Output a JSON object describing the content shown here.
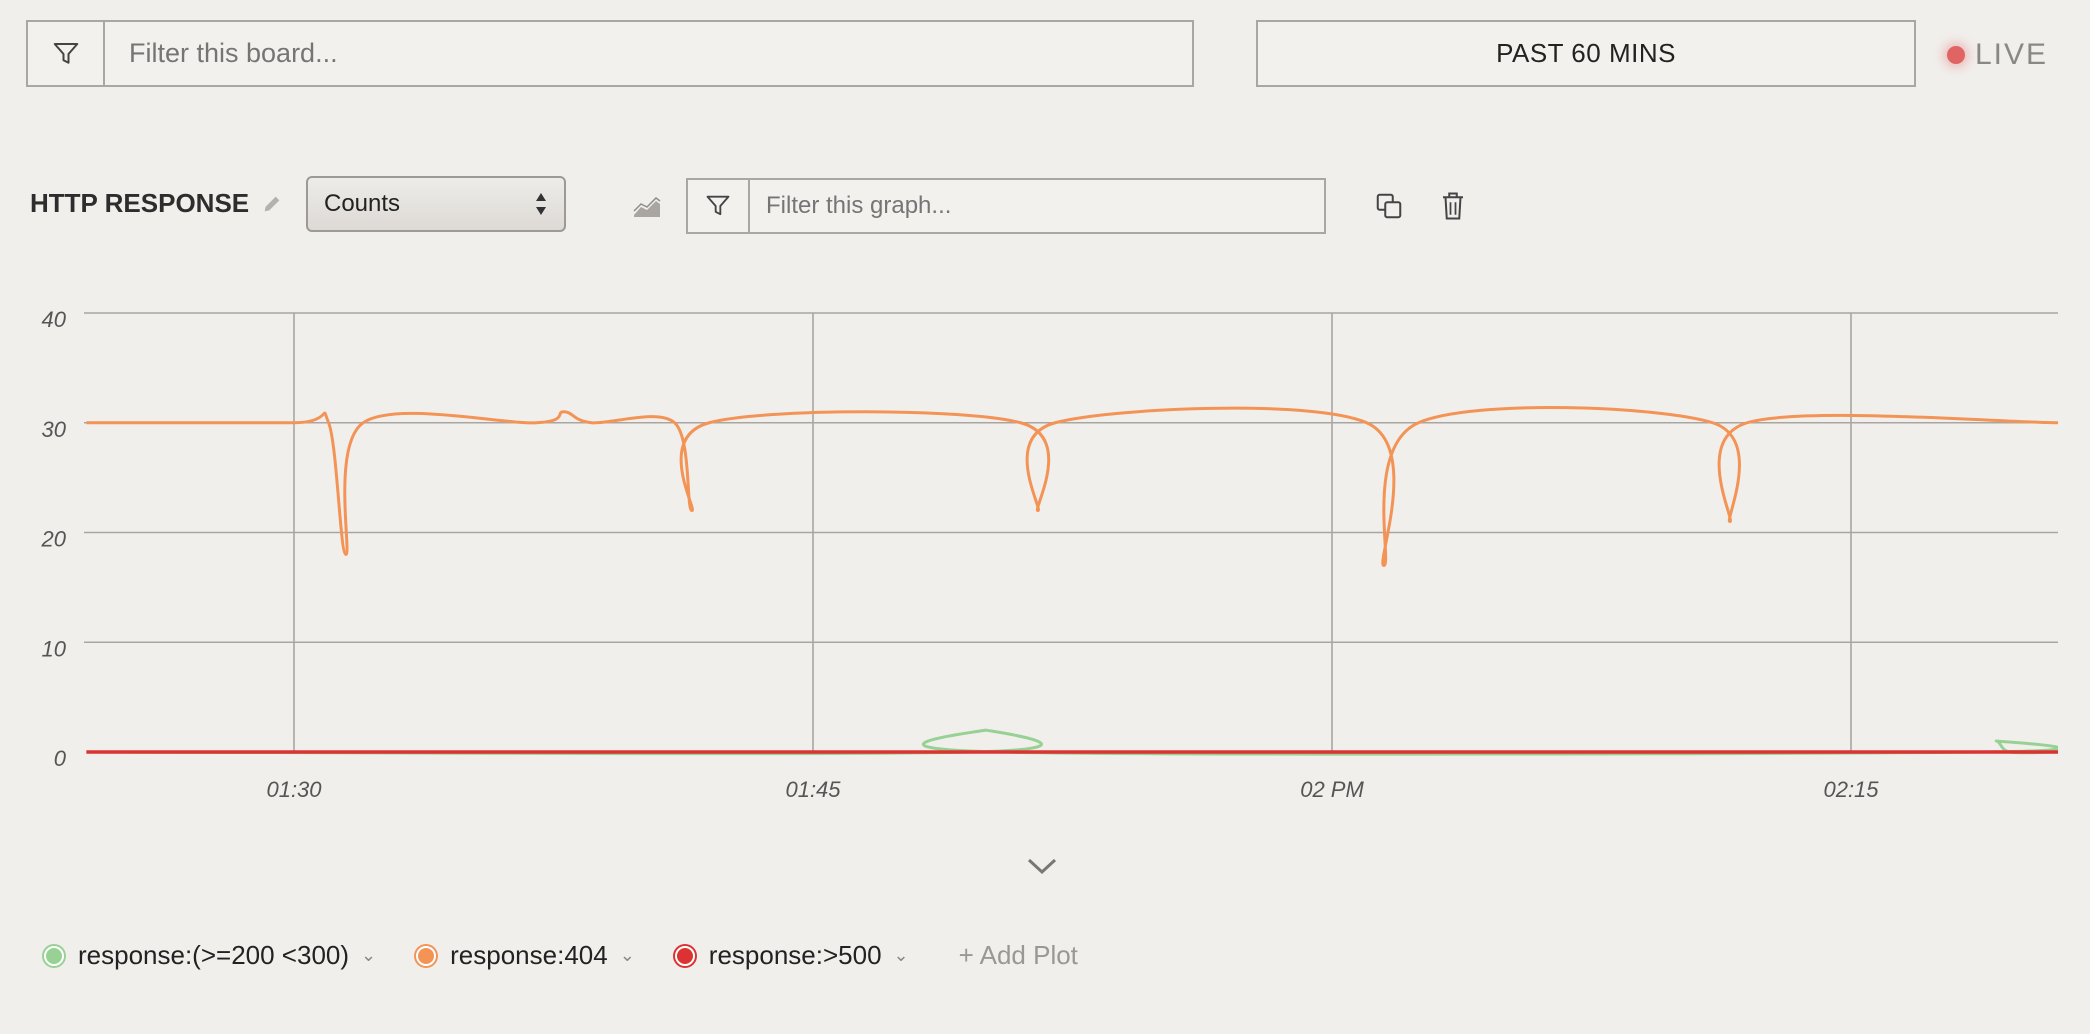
{
  "board_filter": {
    "placeholder": "Filter this board..."
  },
  "time_range": {
    "label": "PAST 60 MINS"
  },
  "live": {
    "label": "LIVE",
    "color": "#e06464"
  },
  "graph": {
    "title": "HTTP RESPONSE",
    "aggregation": "Counts",
    "filter_placeholder": "Filter this graph..."
  },
  "legend": {
    "items": [
      {
        "label": "response:(>=200 <300)",
        "color": "#98d194"
      },
      {
        "label": "response:404",
        "color": "#f39456"
      },
      {
        "label": "response:>500",
        "color": "#dc3232"
      }
    ],
    "add_plot": "+ Add Plot"
  },
  "chart_data": {
    "type": "line",
    "ylim": [
      0,
      40
    ],
    "yticks": [
      "0",
      "10",
      "20",
      "30",
      "40"
    ],
    "xlim_minutes": [
      -20,
      70
    ],
    "xticks": [
      {
        "label": "01:30",
        "t": 0
      },
      {
        "label": "01:45",
        "t": 15
      },
      {
        "label": "02 PM",
        "t": 30
      },
      {
        "label": "02:15",
        "t": 45
      }
    ],
    "grid": true,
    "legend_position": "bottom",
    "series": [
      {
        "name": "response:404",
        "color": "#f39456",
        "points": [
          [
            -6,
            30
          ],
          [
            0,
            30
          ],
          [
            1.0,
            30
          ],
          [
            1.5,
            18
          ],
          [
            2.0,
            30
          ],
          [
            7,
            30
          ],
          [
            7.8,
            31
          ],
          [
            8.6,
            30
          ],
          [
            11.0,
            30
          ],
          [
            11.5,
            22
          ],
          [
            12.0,
            30
          ],
          [
            21.0,
            30
          ],
          [
            21.5,
            22
          ],
          [
            22.0,
            30
          ],
          [
            31.0,
            30
          ],
          [
            31.5,
            17
          ],
          [
            32.5,
            30
          ],
          [
            41.0,
            30
          ],
          [
            41.5,
            21
          ],
          [
            42.0,
            30
          ],
          [
            51,
            30
          ]
        ]
      },
      {
        "name": "response:(>=200 <300)",
        "color": "#98d194",
        "points": [
          [
            -6,
            0
          ],
          [
            19.6,
            0
          ],
          [
            20,
            2
          ],
          [
            20.4,
            0
          ],
          [
            48.8,
            0
          ],
          [
            49.2,
            1
          ],
          [
            49.6,
            0
          ],
          [
            51,
            0
          ]
        ]
      },
      {
        "name": "response:>500",
        "color": "#dc3232",
        "points": [
          [
            -6,
            0
          ],
          [
            51,
            0
          ]
        ]
      }
    ]
  }
}
